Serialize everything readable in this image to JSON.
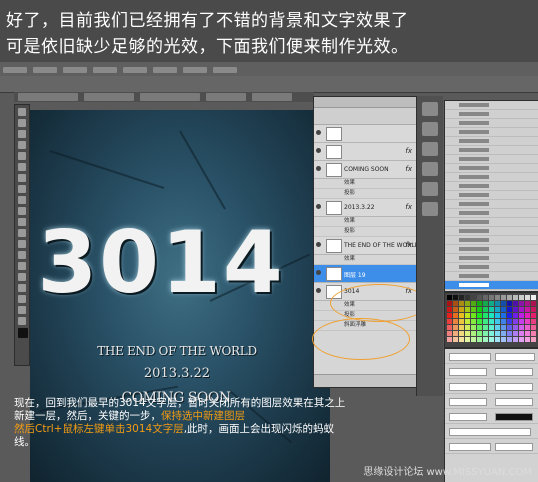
{
  "intro": {
    "line1": "好了，目前我们已经拥有了不错的背景和文字效果了",
    "line2": "可是依旧缺少足够的光效，下面我们便来制作光效。"
  },
  "poster": {
    "headline": "3014",
    "subtitle": "THE END OF THE WORLD",
    "date": "2013.3.22",
    "tagline": "COMING SOON"
  },
  "layers_panel": {
    "layers": [
      {
        "name": "",
        "fx": "",
        "selected": false
      },
      {
        "name": "",
        "fx": "fx",
        "selected": false
      },
      {
        "name": "COMING SOON",
        "fx": "fx",
        "selected": false
      },
      {
        "name": "2013.3.22",
        "fx": "fx",
        "selected": false
      },
      {
        "name": "THE END OF THE WORLD",
        "fx": "fx",
        "selected": false
      },
      {
        "name": "图层 19",
        "fx": "",
        "selected": true
      },
      {
        "name": "3014",
        "fx": "fx",
        "selected": false
      }
    ],
    "effects_label": "效果",
    "effects": [
      "投影",
      "斜面浮雕"
    ]
  },
  "caption": {
    "part1": "现在，回到我们最早的3014文字层，暂时关闭所有的图层效果在其之上新建一层，然后，关键的一步，",
    "highlight1": "保持选中新建图层",
    "part2": "然后Ctrl+鼠标左键单击3014文字层",
    "part3": ",此时，画面上会出现闪烁的蚂蚁线。"
  },
  "watermark": "思缘设计论坛 www.MISSYUAN.COM",
  "colors": {
    "highlight": "#f39c12",
    "selection_blue": "#3d8ee8",
    "ring": "#f0a030"
  }
}
